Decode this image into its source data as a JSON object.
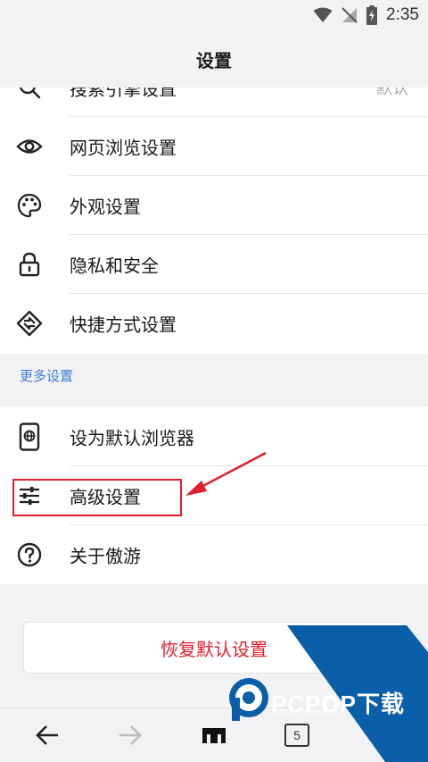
{
  "status_bar": {
    "time": "2:35"
  },
  "header": {
    "title": "设置"
  },
  "group1": {
    "items": [
      {
        "label": "搜索引擎设置",
        "value": "默认",
        "icon": "search-icon"
      },
      {
        "label": "网页浏览设置",
        "icon": "eye-icon"
      },
      {
        "label": "外观设置",
        "icon": "palette-icon"
      },
      {
        "label": "隐私和安全",
        "icon": "lock-icon"
      },
      {
        "label": "快捷方式设置",
        "icon": "shortcut-icon"
      }
    ]
  },
  "section": {
    "title": "更多设置"
  },
  "group2": {
    "items": [
      {
        "label": "设为默认浏览器",
        "icon": "phone-globe-icon"
      },
      {
        "label": "高级设置",
        "icon": "sliders-icon"
      },
      {
        "label": "关于傲游",
        "icon": "help-icon"
      }
    ]
  },
  "restore_button": {
    "label": "恢复默认设置"
  },
  "bottom_nav": {
    "tab_count": "5"
  },
  "watermark": {
    "text": "PCPOP下载",
    "subtext": "PCPOP Download"
  },
  "colors": {
    "accent_red": "#e0202e",
    "section_blue": "#3b7dd8",
    "watermark_blue": "#0a5fa8"
  }
}
